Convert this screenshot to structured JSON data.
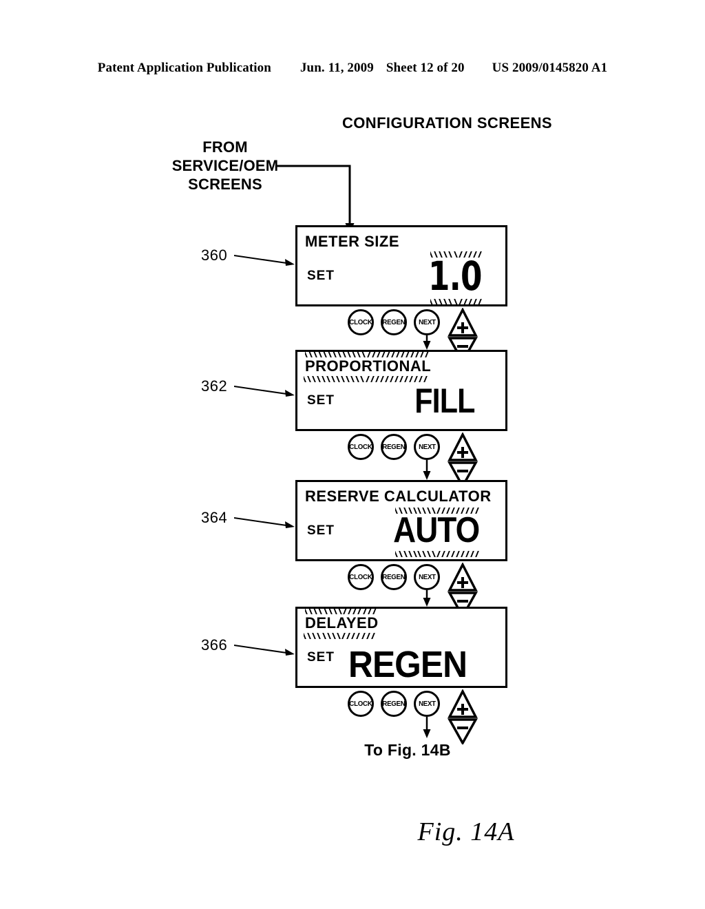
{
  "header": {
    "publication": "Patent Application Publication",
    "date": "Jun. 11, 2009",
    "sheet": "Sheet 12 of 20",
    "docnum": "US 2009/0145820 A1"
  },
  "diagram": {
    "title": "CONFIGURATION SCREENS",
    "entry_label": "FROM\nSERVICE/OEM\nSCREENS",
    "entry_label_line1": "FROM",
    "entry_label_line2": "SERVICE/OEM",
    "entry_label_line3": "SCREENS",
    "exit_label": "To Fig. 14B",
    "figure_label": "Fig. 14A"
  },
  "buttons": {
    "clock": "CLOCK",
    "regen": "REGEN",
    "next": "NEXT",
    "up": "+",
    "down": "−"
  },
  "screens": [
    {
      "ref": "360",
      "title": "METER SIZE",
      "set_label": "SET",
      "value": "1.0",
      "value_blinking": true,
      "title_blinking": false
    },
    {
      "ref": "362",
      "title": "PROPORTIONAL",
      "set_label": "SET",
      "value": "FILL",
      "value_blinking": false,
      "title_blinking": true
    },
    {
      "ref": "364",
      "title": "RESERVE CALCULATOR",
      "set_label": "SET",
      "value": "AUTO",
      "value_blinking": true,
      "title_blinking": false
    },
    {
      "ref": "366",
      "title": "DELAYED",
      "set_label": "SET",
      "value": "REGEN",
      "value_blinking": false,
      "title_blinking": true
    }
  ]
}
